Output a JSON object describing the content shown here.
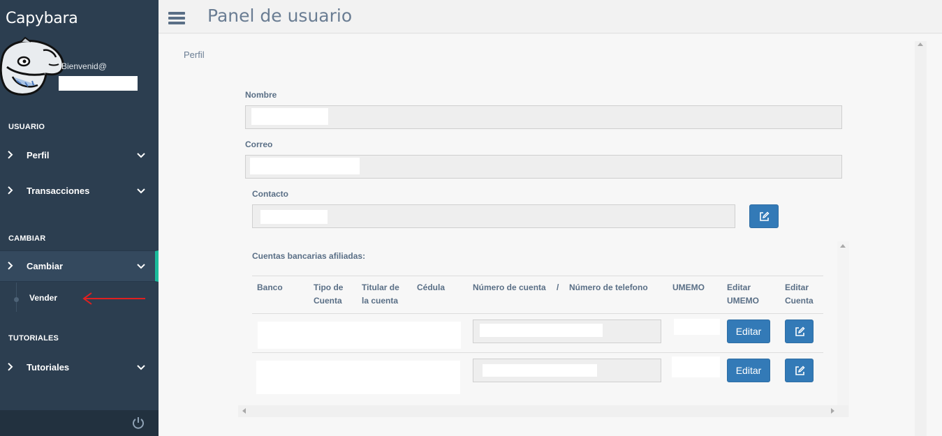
{
  "sidebar": {
    "brand": "Capybara",
    "welcome": "Bienvenid@",
    "sections": {
      "usuario": "USUARIO",
      "cambiar": "CAMBIAR",
      "tutoriales": "TUTORIALES"
    },
    "items": {
      "perfil": "Perfil",
      "transacciones": "Transacciones",
      "cambiar": "Cambiar",
      "vender": "Vender",
      "tutoriales": "Tutoriales"
    }
  },
  "header": {
    "title": "Panel de usuario"
  },
  "main": {
    "breadcrumb": "Perfil",
    "labels": {
      "nombre": "Nombre",
      "correo": "Correo",
      "contacto": "Contacto",
      "cuentas": "Cuentas bancarias afiliadas:"
    },
    "table": {
      "headers": {
        "banco": "Banco",
        "tipo_1": "Tipo de",
        "tipo_2": "Cuenta",
        "titular_1": "Titular de",
        "titular_2": "la cuenta",
        "cedula": "Cédula",
        "numero": "Número de cuenta",
        "separator": "/",
        "telefono": "Número de telefono",
        "umemo": "UMEMO",
        "editar_umemo_1": "Editar",
        "editar_umemo_2": "UMEMO",
        "editar_cuenta_1": "Editar",
        "editar_cuenta_2": "Cuenta"
      },
      "rows": [
        {
          "edit_label": "Editar"
        },
        {
          "edit_label": "Editar"
        }
      ]
    }
  },
  "colors": {
    "sidebar_bg": "#2c3e50",
    "accent": "#1abc9c",
    "button_primary": "#337ab7",
    "arrow": "#e02020"
  }
}
